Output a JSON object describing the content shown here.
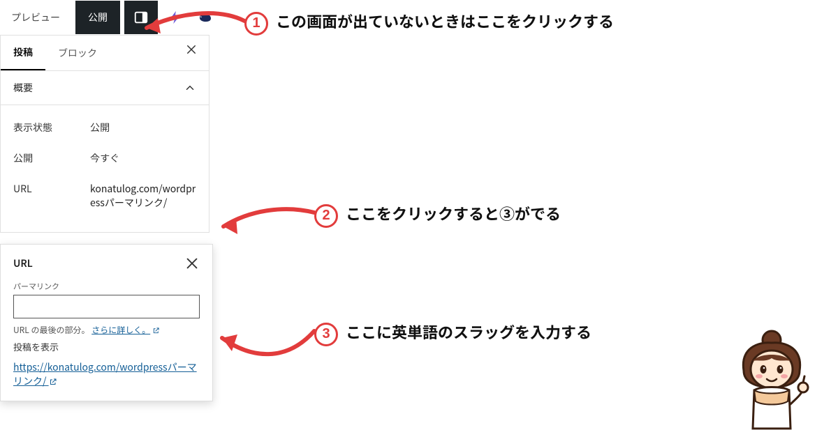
{
  "toolbar": {
    "preview_label": "プレビュー",
    "publish_label": "公開"
  },
  "sidebar": {
    "tabs": {
      "post": "投稿",
      "block": "ブロック"
    },
    "section_summary": "概要",
    "rows": {
      "visibility_label": "表示状態",
      "visibility_value": "公開",
      "publish_label": "公開",
      "publish_value": "今すぐ",
      "url_label": "URL",
      "url_value": "konatulog.com/wordpressパーマリンク/"
    }
  },
  "popover": {
    "title": "URL",
    "field_label": "パーマリンク",
    "input_value": "",
    "hint_prefix": "URL の最後の部分。",
    "hint_link": "さらに詳しく。",
    "view_label": "投稿を表示",
    "permalink": "https://konatulog.com/wordpressパーマリンク/"
  },
  "annotations": {
    "a1": "この画面が出ていないときはここをクリックする",
    "a2": "ここをクリックすると③がでる",
    "a3": "ここに英単語のスラッグを入力する",
    "n1": "1",
    "n2": "2",
    "n3": "3"
  }
}
